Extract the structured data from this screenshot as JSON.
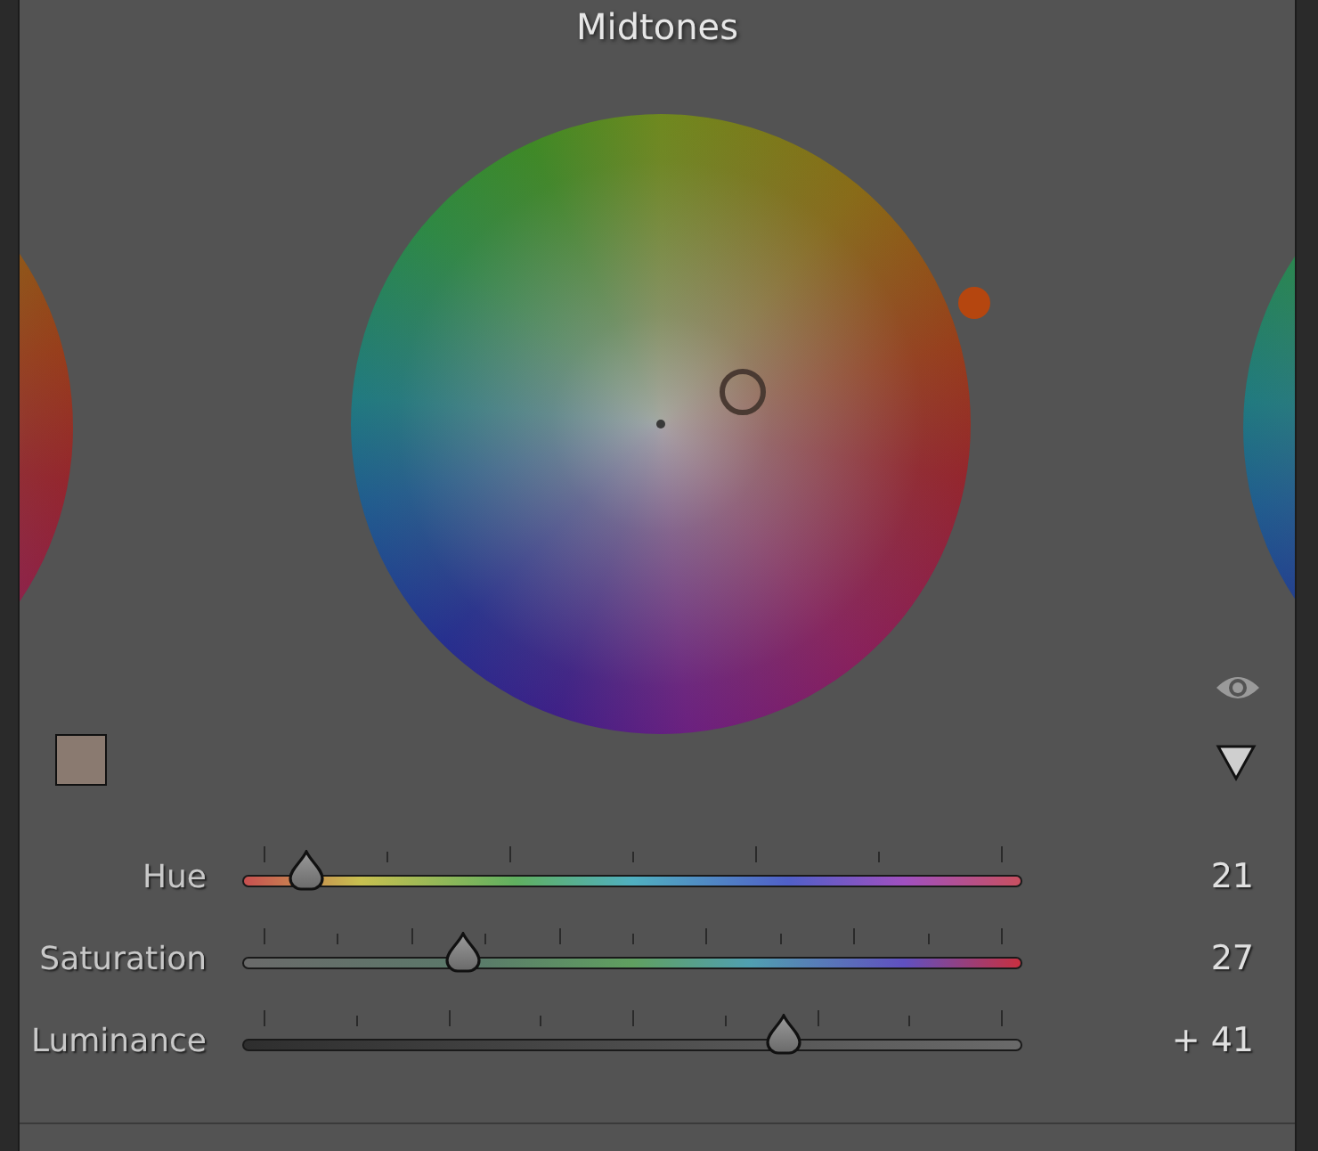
{
  "panel": {
    "title": "Midtones"
  },
  "sliders": [
    {
      "kind": "hue",
      "label": "Hue",
      "level": 0.082,
      "reading": "21"
    },
    {
      "kind": "saturation",
      "label": "Saturation",
      "level": 0.283,
      "reading": "27"
    },
    {
      "kind": "luminance",
      "label": "Luminance",
      "level": 0.694,
      "reading": "+ 41"
    }
  ]
}
